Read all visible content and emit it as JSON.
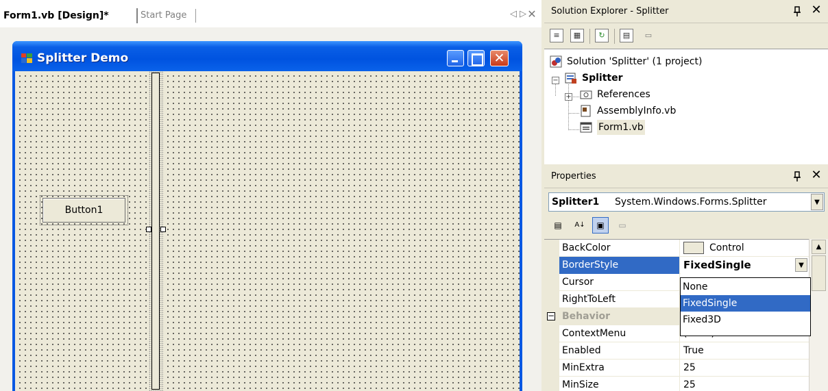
{
  "doc_tabs": {
    "active": "Form1.vb [Design]*",
    "inactive": "Start Page",
    "prev_glyph": "◁",
    "next_glyph": "▷",
    "close_glyph": "✕"
  },
  "form": {
    "title": "Splitter Demo",
    "button_label": "Button1",
    "close_glyph": "✕"
  },
  "solution_explorer": {
    "title": "Solution Explorer - Splitter",
    "pin_glyph": "ᵖ",
    "close_glyph": "✕",
    "toolbar": [
      "properties-icon",
      "show-all-files-icon",
      "refresh-icon",
      "view-code-icon",
      "view-designer-icon"
    ],
    "tree": {
      "solution": "Solution 'Splitter' (1 project)",
      "project": "Splitter",
      "references": "References",
      "assembly_info": "AssemblyInfo.vb",
      "form1": "Form1.vb",
      "collapse_glyph": "−",
      "expand_glyph": "+"
    }
  },
  "properties": {
    "title": "Properties",
    "pin_glyph": "ᵖ",
    "close_glyph": "✕",
    "selected_object": {
      "name": "Splitter1",
      "type": "System.Windows.Forms.Splitter"
    },
    "grid": [
      {
        "name": "BackColor",
        "value": "Control"
      },
      {
        "name": "BorderStyle",
        "value": "FixedSingle"
      },
      {
        "name": "Cursor",
        "value": ""
      },
      {
        "name": "RightToLeft",
        "value": ""
      },
      {
        "category": "Behavior"
      },
      {
        "name": "ContextMenu",
        "value": "(none)"
      },
      {
        "name": "Enabled",
        "value": "True"
      },
      {
        "name": "MinExtra",
        "value": "25"
      },
      {
        "name": "MinSize",
        "value": "25"
      }
    ],
    "dropdown_options": [
      "None",
      "FixedSingle",
      "Fixed3D"
    ],
    "dropdown_selected": "FixedSingle",
    "category_toggle": "−"
  },
  "colors": {
    "selection": "#316ac5",
    "title_bar": "#0053e0",
    "panel_bg": "#ece9d8"
  }
}
